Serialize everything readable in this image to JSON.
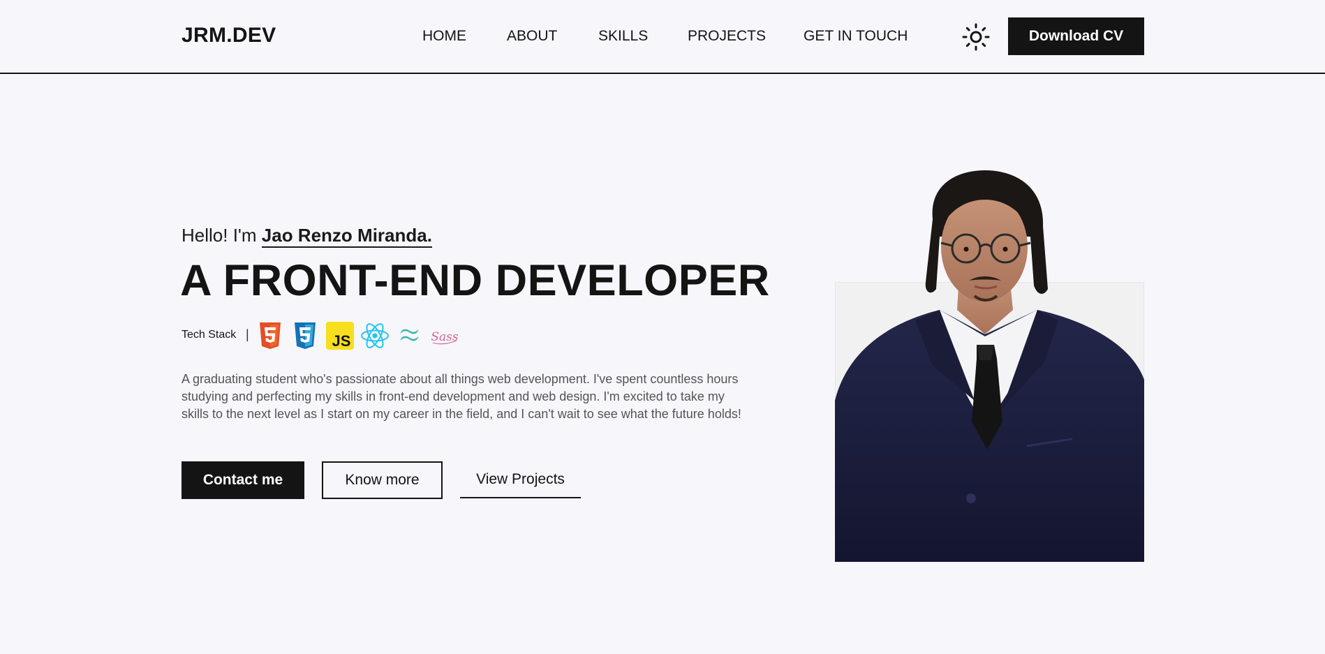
{
  "header": {
    "logo": "JRM.DEV",
    "nav": [
      {
        "label": "HOME"
      },
      {
        "label": "ABOUT"
      },
      {
        "label": "SKILLS"
      },
      {
        "label": "PROJECTS"
      },
      {
        "label": "GET IN TOUCH"
      }
    ],
    "theme_icon": "sun-icon",
    "download_label": "Download CV"
  },
  "hero": {
    "greeting_prefix": "Hello! I'm",
    "name": "Jao Renzo Miranda.",
    "headline": "A FRONT-END DEVELOPER",
    "tech_label": "Tech Stack",
    "tech_separator": "|",
    "tech_icons": [
      "html5-icon",
      "css3-icon",
      "javascript-icon",
      "react-icon",
      "tailwind-icon",
      "sass-icon"
    ],
    "bio": "A graduating student who's passionate about all things web development. I've spent countless hours studying and perfecting my skills in front-end development and web design. I'm excited to take my skills to the next level as I start on my career in the field, and I can't wait to see what the future holds!",
    "buttons": {
      "contact": "Contact me",
      "know_more": "Know more",
      "view_projects": "View Projects"
    },
    "sass_text": "Sass",
    "js_text": "JS"
  },
  "colors": {
    "background": "#f7f6fa",
    "primary": "#141414",
    "body_text": "#545454",
    "html5": "#e44d26",
    "css3": "#1572b6",
    "javascript": "#f7df1e",
    "react": "#61dafb",
    "tailwind": "#38b2ac",
    "sass": "#cc6699",
    "suit": "#1c1f3a"
  }
}
